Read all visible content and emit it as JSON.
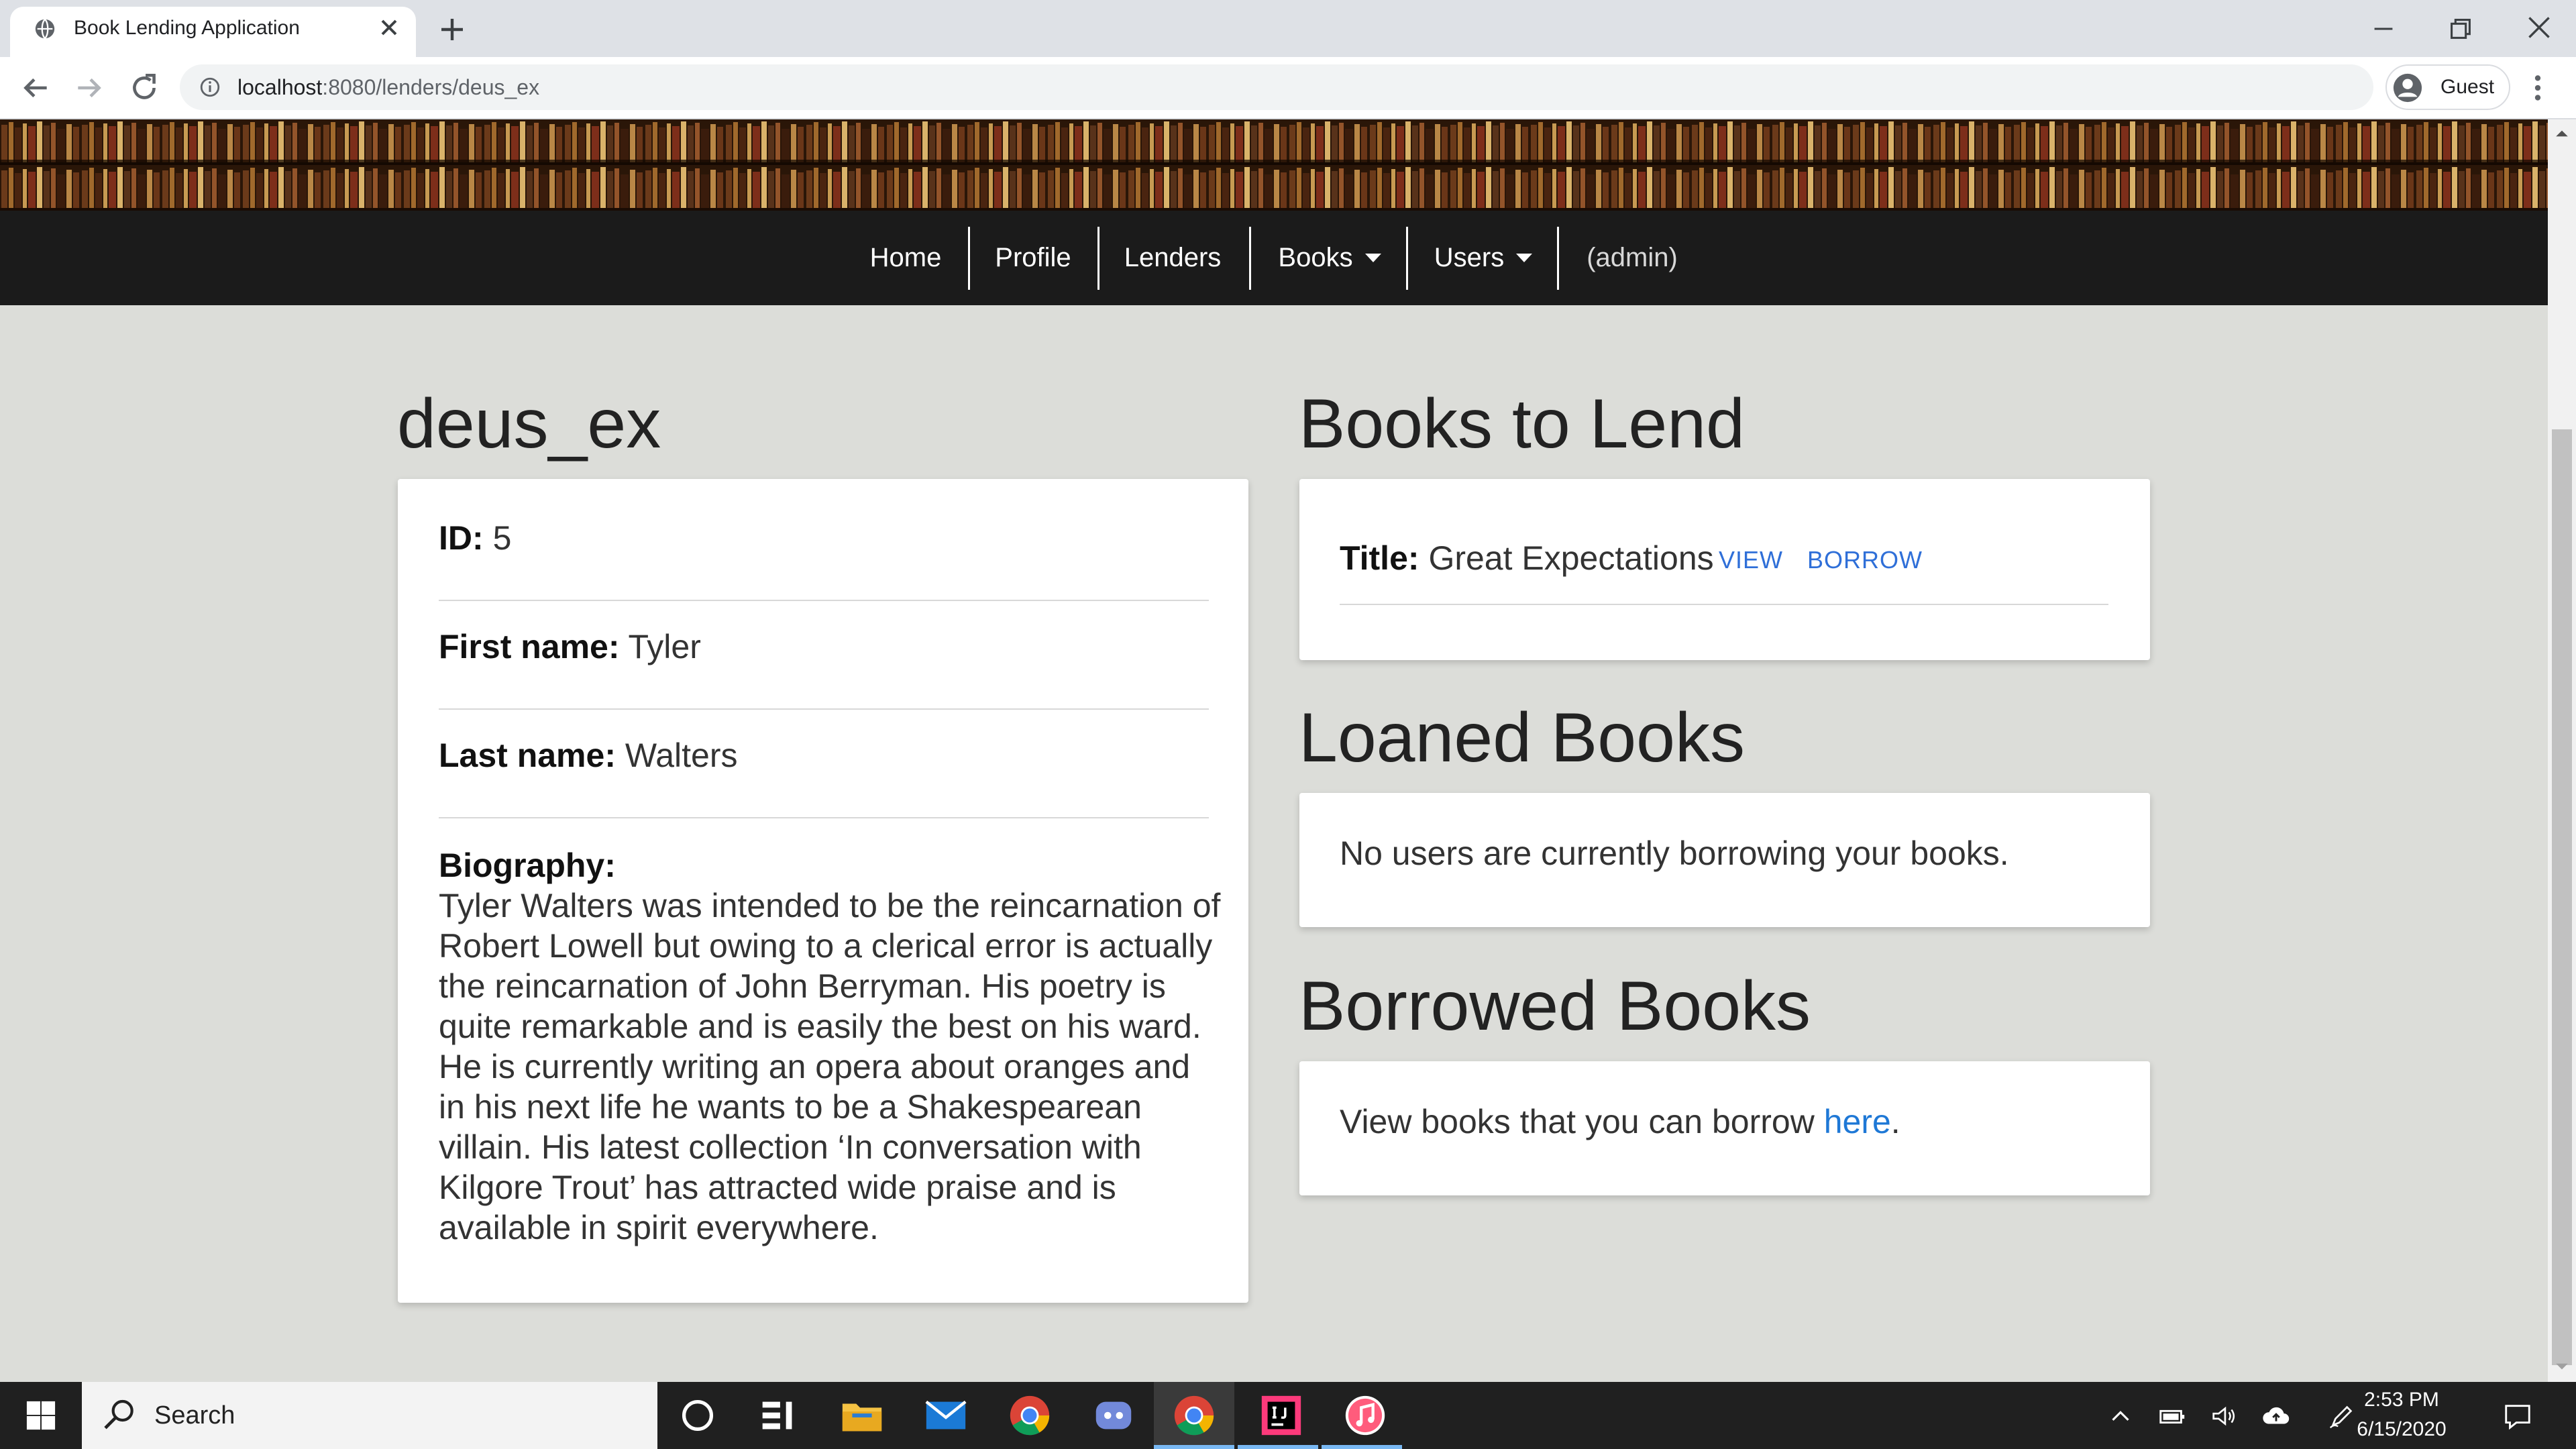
{
  "browser": {
    "tab_title": "Book Lending Application",
    "url_host": "localhost",
    "url_path": ":8080/lenders/deus_ex",
    "profile_label": "Guest"
  },
  "navbar": {
    "items": [
      {
        "label": "Home"
      },
      {
        "label": "Profile"
      },
      {
        "label": "Lenders"
      },
      {
        "label": "Books"
      },
      {
        "label": "Users"
      },
      {
        "label": "(admin)"
      }
    ]
  },
  "lender": {
    "username": "deus_ex",
    "id_label": "ID:",
    "id_value": "5",
    "first_name_label": "First name:",
    "first_name_value": "Tyler",
    "last_name_label": "Last name:",
    "last_name_value": "Walters",
    "bio_label": "Biography:",
    "bio_lines": [
      "Tyler Walters was intended to be the reincarnation of",
      "Robert Lowell but owing to a clerical error is actually",
      "the reincarnation of John Berryman. His poetry is",
      "quite remarkable and is easily the best on his ward.",
      "He is currently writing an opera about oranges and",
      "in his next life he wants to be a Shakespearean",
      "villain. His latest collection ‘In conversation with",
      "Kilgore Trout’ has attracted wide praise and is",
      "available in spirit everywhere."
    ]
  },
  "books_to_lend": {
    "heading": "Books to Lend",
    "title_label": "Title:",
    "title_value": "Great Expectations",
    "view_label": "VIEW",
    "borrow_label": "BORROW"
  },
  "loaned_books": {
    "heading": "Loaned Books",
    "message": "No users are currently borrowing your books."
  },
  "borrowed_books": {
    "heading": "Borrowed Books",
    "message_prefix": "View books that you can borrow ",
    "link_label": "here",
    "message_suffix": "."
  },
  "taskbar": {
    "search_placeholder": "Search",
    "time": "2:53 PM",
    "date": "6/15/2020"
  },
  "colors": {
    "page_bg": "#dcddd9",
    "navbar_bg": "#1b1b1b",
    "link": "#1e78d6",
    "small_link": "#2f6fd8"
  }
}
